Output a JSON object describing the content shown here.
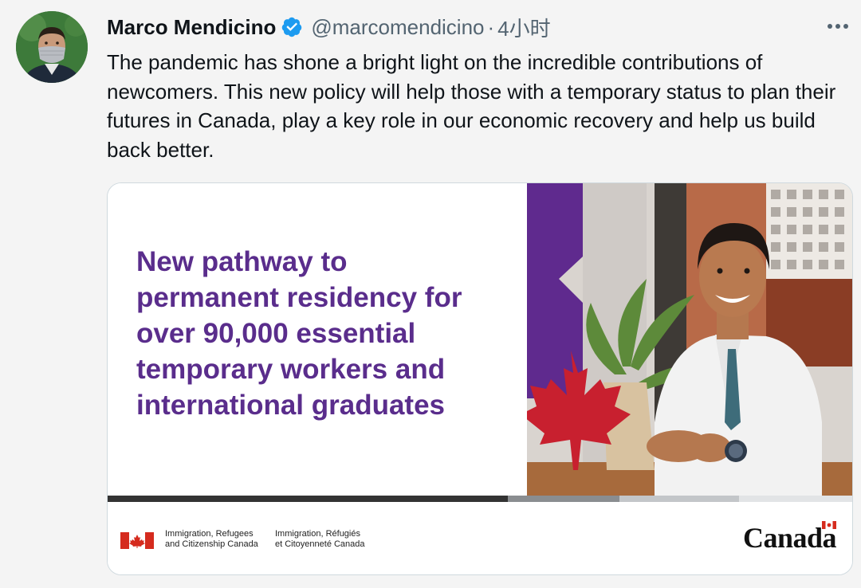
{
  "tweet": {
    "author": {
      "display_name": "Marco Mendicino",
      "handle": "@marcomendicino",
      "verified": true
    },
    "separator": "·",
    "time": "4小时",
    "text": "The pandemic has shone a bright light on the incredible contributions of newcomers. This new policy will help those with a temporary status to plan their futures in Canada, play a key role in our economic recovery and help us build back better.",
    "icons": {
      "verified": "verified-badge-icon",
      "more": "more-options-icon",
      "flag": "canada-flag-icon",
      "maple_leaf": "maple-leaf-icon"
    },
    "colors": {
      "verified": "#1d9bf0",
      "headline": "#5a2d8c",
      "purple_ribbon": "#5f2a8e",
      "maple_red": "#c8202f"
    }
  },
  "card": {
    "headline": "New pathway to\npermanent residency for\nover 90,000 essential\ntemporary workers and\ninternational graduates",
    "dept_en": "Immigration, Refugees\nand Citizenship Canada",
    "dept_fr": "Immigration, Réfugiés\net Citoyenneté Canada",
    "wordmark": "Canada"
  }
}
